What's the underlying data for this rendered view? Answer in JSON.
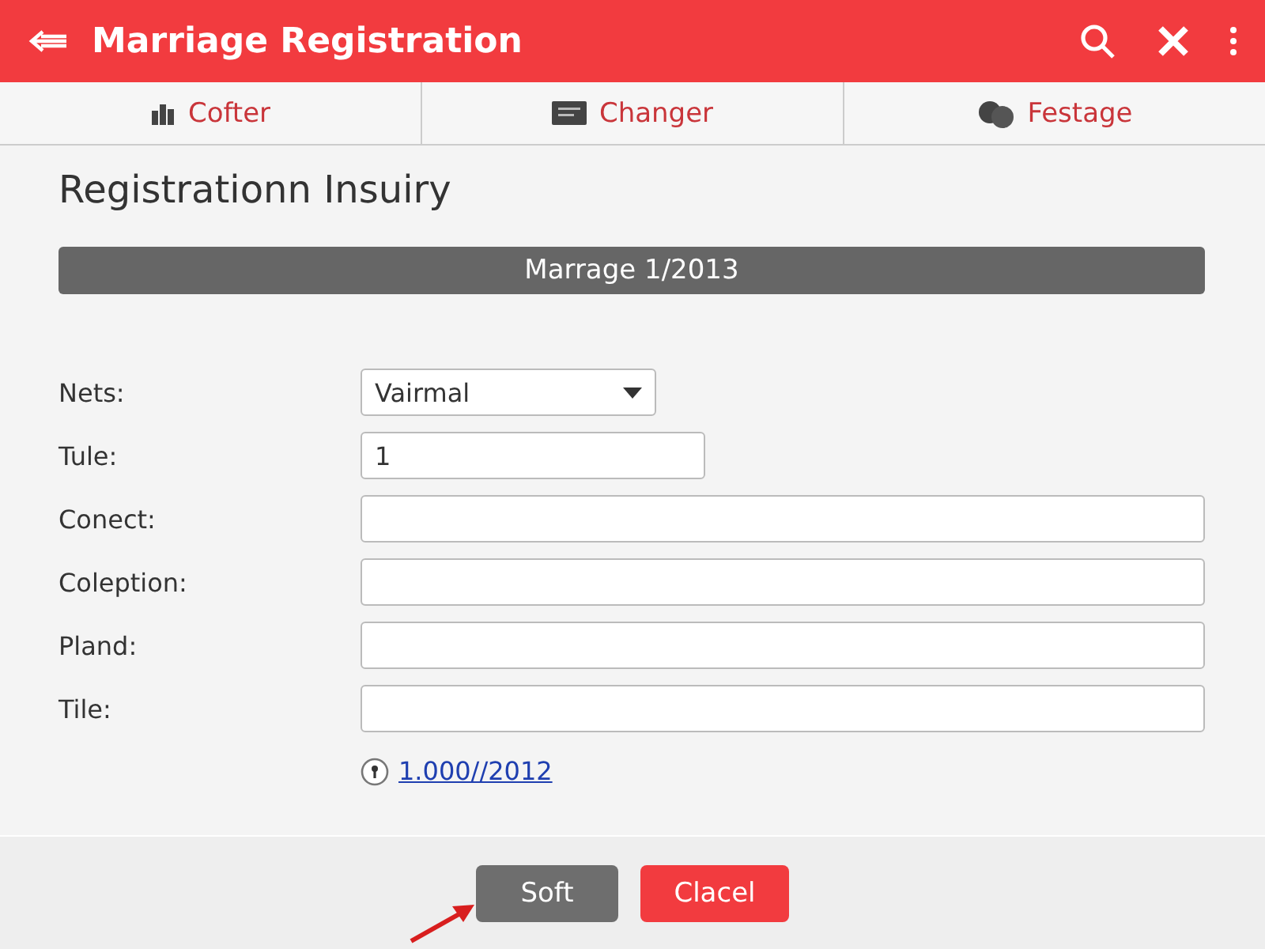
{
  "header": {
    "title": "Marriage Registration"
  },
  "tabs": [
    {
      "label": "Cofter",
      "kind": "chart",
      "selected": false
    },
    {
      "label": "Changer",
      "kind": "card",
      "selected": false
    },
    {
      "label": "Festage",
      "kind": "chat",
      "selected": false
    }
  ],
  "heading": "Registrationn Insuiry",
  "section_bar": "Marrage 1/2013",
  "fields": [
    {
      "label": "Nets:",
      "kind": "select",
      "value": "Vairmal"
    },
    {
      "label": "Tule:",
      "kind": "short",
      "value": "1"
    },
    {
      "label": "Conect:",
      "kind": "text"
    },
    {
      "label": "Coleption:",
      "kind": "text"
    },
    {
      "label": "Pland:",
      "kind": "text"
    },
    {
      "label": "Tile:",
      "kind": "text"
    }
  ],
  "link": "1.000//2012",
  "buttons": [
    {
      "label": "Soft",
      "kind": "secondary"
    },
    {
      "label": "Clacel",
      "kind": "danger"
    }
  ]
}
